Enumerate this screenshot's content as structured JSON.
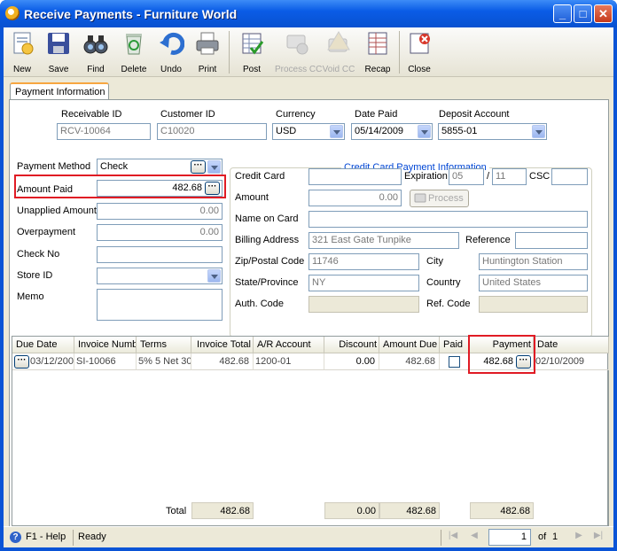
{
  "window": {
    "title": "Receive Payments - Furniture World",
    "min": "_",
    "max": "□",
    "close": "✕"
  },
  "toolbar": [
    {
      "label": "New",
      "icon": "new-record-icon",
      "enabled": true
    },
    {
      "label": "Save",
      "icon": "floppy-disk-icon",
      "enabled": true
    },
    {
      "label": "Find",
      "icon": "binoculars-icon",
      "enabled": true
    },
    {
      "label": "Delete",
      "icon": "recycle-bin-icon",
      "enabled": true
    },
    {
      "label": "Undo",
      "icon": "undo-arrow-icon",
      "enabled": true
    },
    {
      "label": "Print",
      "icon": "printer-icon",
      "enabled": true
    },
    {
      "label": "Post",
      "icon": "post-ledger-icon",
      "enabled": true
    },
    {
      "label": "Process CC",
      "icon": "process-cc-icon",
      "enabled": false
    },
    {
      "label": "Void CC",
      "icon": "void-cc-icon",
      "enabled": false
    },
    {
      "label": "Recap",
      "icon": "recap-icon",
      "enabled": true
    },
    {
      "label": "Close",
      "icon": "close-doc-icon",
      "enabled": true
    }
  ],
  "tab": "Payment Information",
  "header": {
    "receivable_id_label": "Receivable ID",
    "receivable_id": "RCV-10064",
    "customer_id_label": "Customer ID",
    "customer_id": "C10020",
    "currency_label": "Currency",
    "currency": "USD",
    "date_paid_label": "Date Paid",
    "date_paid": "05/14/2009",
    "deposit_account_label": "Deposit Account",
    "deposit_account": "5855-01"
  },
  "payment": {
    "method_label": "Payment Method",
    "method": "Check",
    "amount_paid_label": "Amount Paid",
    "amount_paid": "482.68",
    "unapplied_label": "Unapplied Amount",
    "unapplied": "0.00",
    "overpayment_label": "Overpayment",
    "overpayment": "0.00",
    "check_no_label": "Check No",
    "check_no": "",
    "store_id_label": "Store ID",
    "store_id": "",
    "memo_label": "Memo",
    "memo": ""
  },
  "cc": {
    "title": "Credit Card Payment Information",
    "credit_card_label": "Credit Card",
    "credit_card": "",
    "expiration_label": "Expiration",
    "exp_month": "05",
    "exp_sep": "/",
    "exp_year": "11",
    "csc_label": "CSC",
    "csc": "",
    "amount_label": "Amount",
    "amount": "0.00",
    "process_button": "Process",
    "name_label": "Name on Card",
    "name": "",
    "billing_label": "Billing Address",
    "billing": "321 East Gate Tunpike",
    "reference_label": "Reference",
    "reference": "",
    "zip_label": "Zip/Postal Code",
    "zip": "11746",
    "city_label": "City",
    "city": "Huntington Station",
    "state_label": "State/Province",
    "state": "NY",
    "country_label": "Country",
    "country": "United States",
    "auth_label": "Auth. Code",
    "auth": "",
    "refcode_label": "Ref. Code",
    "refcode": ""
  },
  "grid": {
    "columns": [
      "Due Date",
      "Invoice Numb",
      "Terms",
      "Invoice Total",
      "A/R Account",
      "Discount",
      "Amount Due",
      "Paid",
      "Payment",
      "Date"
    ],
    "rows": [
      {
        "due_date": "03/12/200",
        "invoice": "SI-10066",
        "terms": "5% 5 Net 30",
        "invoice_total": "482.68",
        "ar_account": "1200-01",
        "discount": "0.00",
        "amount_due": "482.68",
        "paid": false,
        "payment": "482.68",
        "date": "02/10/2009"
      }
    ],
    "total_label": "Total",
    "totals": {
      "invoice_total": "482.68",
      "discount": "0.00",
      "amount_due": "482.68",
      "payment": "482.68"
    }
  },
  "status": {
    "help": "F1 - Help",
    "state": "Ready",
    "page": "1",
    "of_label": "of",
    "pages": "1"
  },
  "colors": {
    "highlight": "#e01b24",
    "title_bar": "#0a5ce6",
    "group_title": "#0046d5"
  }
}
